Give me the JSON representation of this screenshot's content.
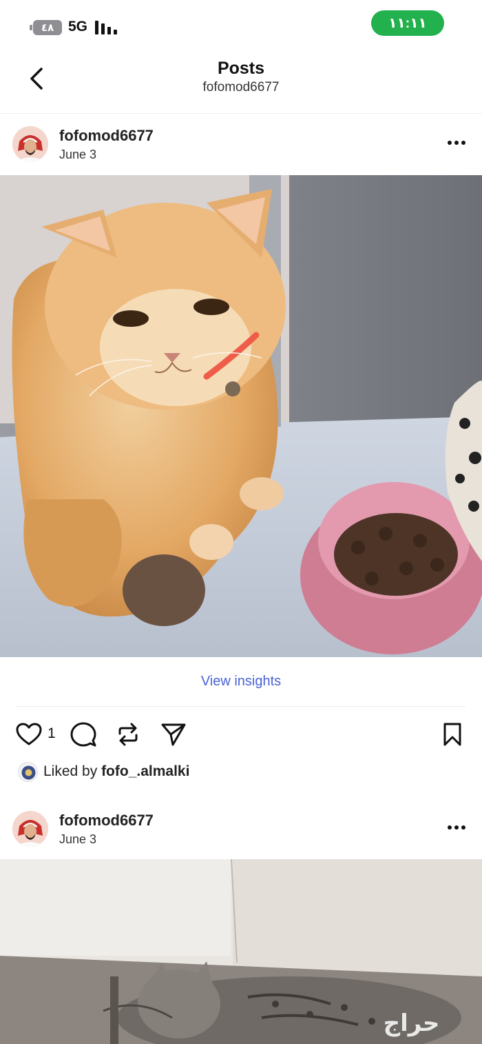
{
  "status_bar": {
    "battery": "٤٨",
    "network": "5G",
    "time": "١١:١١",
    "colors": {
      "time_pill": "#22b14c",
      "battery": "#8e8e93"
    }
  },
  "header": {
    "title": "Posts",
    "subtitle": "fofomod6677",
    "back_icon": "chevron-left-icon"
  },
  "posts": [
    {
      "username": "fofomod6677",
      "date": "June 3",
      "image": "orange-cat-with-food-bowl",
      "insights_label": "View insights",
      "like_count": "1",
      "liked_by_prefix": "Liked by",
      "liked_by_user": "fofo_.almalki",
      "icons": [
        "heart-icon",
        "comment-icon",
        "repost-icon",
        "share-icon",
        "bookmark-icon"
      ]
    },
    {
      "username": "fofomod6677",
      "date": "June 3",
      "image": "tabby-kitten-sleeping"
    }
  ],
  "watermark": "حراج",
  "colors": {
    "link": "#4a63d8",
    "text": "#111111"
  }
}
